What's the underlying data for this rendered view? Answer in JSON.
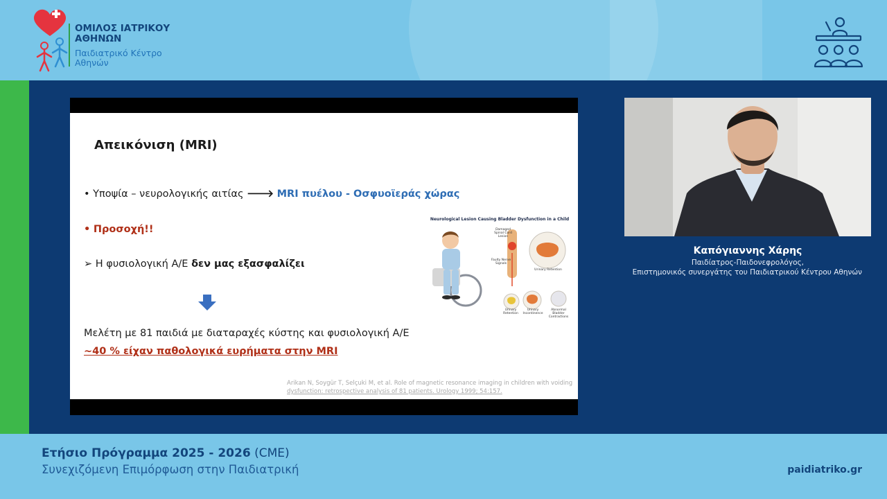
{
  "header": {
    "logo_title_line1": "ΟΜΙΛΟΣ ΙΑΤΡΙΚΟΥ",
    "logo_title_line2": "ΑΘΗΝΩΝ",
    "logo_sub_line1": "Παιδιατρικό Κέντρο",
    "logo_sub_line2": "Αθηνών",
    "logo_icon": "heart-cross-children-icon",
    "conference_icon": "speaker-audience-icon"
  },
  "slide": {
    "title": "Απεικόνιση (MRI)",
    "bullet1_text": "Υποψία – νευρολογικής αιτίας ",
    "bullet1_arrow": "🡒",
    "bullet1_highlight": "MRI πυέλου - Οσφυοϊεράς χώρας",
    "bullet2": "Προσοχή!!",
    "sub_arrow": "➢",
    "sub_text": "Η φυσιολογική Α/Ε ",
    "sub_bold": "δεν μας εξασφαλίζει",
    "study_line": "Μελέτη με 81 παιδιά με διαταραχές κύστης και φυσιολογική Α/Ε",
    "result_line": "~40 %  είχαν παθολογικά ευρήματα στην MRI",
    "citation_line1": "Arikan N, Soygür T, Selçuki M, et al. Role of magnetic resonance imaging in children with voiding",
    "citation_line2": "dysfunction: retrospective analysis of 81 patients. Urology 1999; 54:157.",
    "illustration": {
      "title": "Neurological Lesion Causing Bladder Dysfunction in a Child",
      "label_damaged": "Damaged Spinal Cord Lesion",
      "label_faulty": "Faulty Nerve Signals",
      "label_retention_top": "Urinary Retention",
      "label_retention": "Urinary Retention",
      "label_incontinence": "Urinary Incontinence",
      "label_abnormal": "Abnormal Bladder Contractions"
    }
  },
  "speaker": {
    "name": "Καπόγιαννης Χάρης",
    "role": "Παιδίατρος-Παιδονεφρολόγος,",
    "affiliation": "Επιστημονικός συνεργάτης του Παιδιατρικού Κέντρου Αθηνών"
  },
  "footer": {
    "program_bold": "Ετήσιο Πρόγραμμα 2025 - 2026",
    "program_cme": " (CME)",
    "subtitle": "Συνεχιζόμενη Επιμόρφωση στην Παιδιατρική",
    "website": "paidiatriko.gr"
  }
}
